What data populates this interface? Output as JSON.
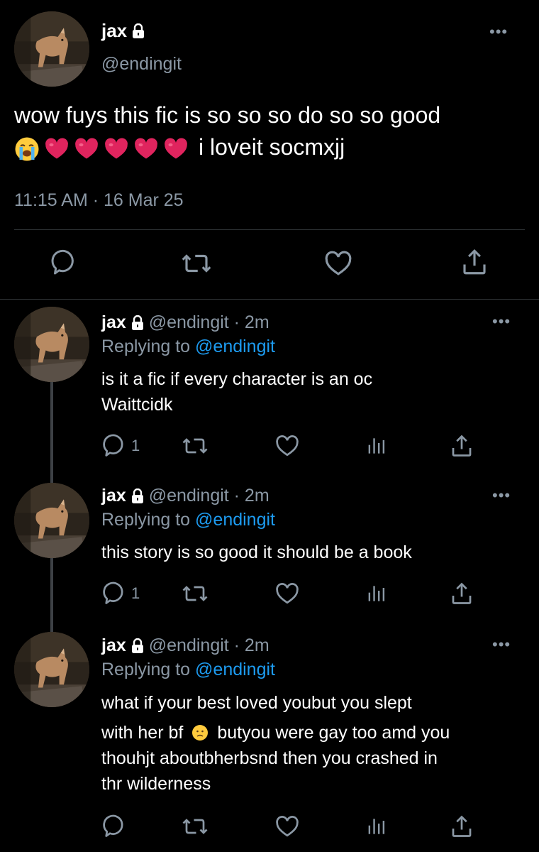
{
  "main_tweet": {
    "name": "jax",
    "handle": "@endingit",
    "text_line1": "wow fuys this fic is so so so do so so good",
    "emojis": [
      "loudly-crying-face",
      "red-heart",
      "red-heart",
      "red-heart",
      "red-heart",
      "red-heart"
    ],
    "text_line2": "i loveit socmxjj",
    "timestamp": "11:15 AM · 16 Mar 25",
    "more": "•••"
  },
  "replies": [
    {
      "name": "jax",
      "meta": "@endingit · 2m",
      "replying_prefix": "Replying to ",
      "replying_handle": "@endingit",
      "text_lines": [
        "is it a fic if every character is an oc",
        "Waittcidk"
      ],
      "reply_count": "1",
      "more": "•••"
    },
    {
      "name": "jax",
      "meta": "@endingit · 2m",
      "replying_prefix": "Replying to ",
      "replying_handle": "@endingit",
      "text_lines": [
        "this story is so good it should be a book"
      ],
      "reply_count": "1",
      "more": "•••"
    },
    {
      "name": "jax",
      "meta": "@endingit · 2m",
      "replying_prefix": "Replying to ",
      "replying_handle": "@endingit",
      "text_line1": "what if your best loved youbut you slept",
      "text_line2a": "with her bf",
      "text_line2_emoji": "worried-face",
      "text_line2b": "butyou were gay too amd you",
      "text_line3": "thouhjt aboutbherbsnd then you crashed in",
      "text_line4": "thr wilderness",
      "reply_count": "",
      "more": "•••"
    }
  ],
  "colors": {
    "background": "#000000",
    "text": "#ffffff",
    "secondary": "#8b98a5",
    "link": "#1d9bf0",
    "heart": "#e0245e"
  }
}
